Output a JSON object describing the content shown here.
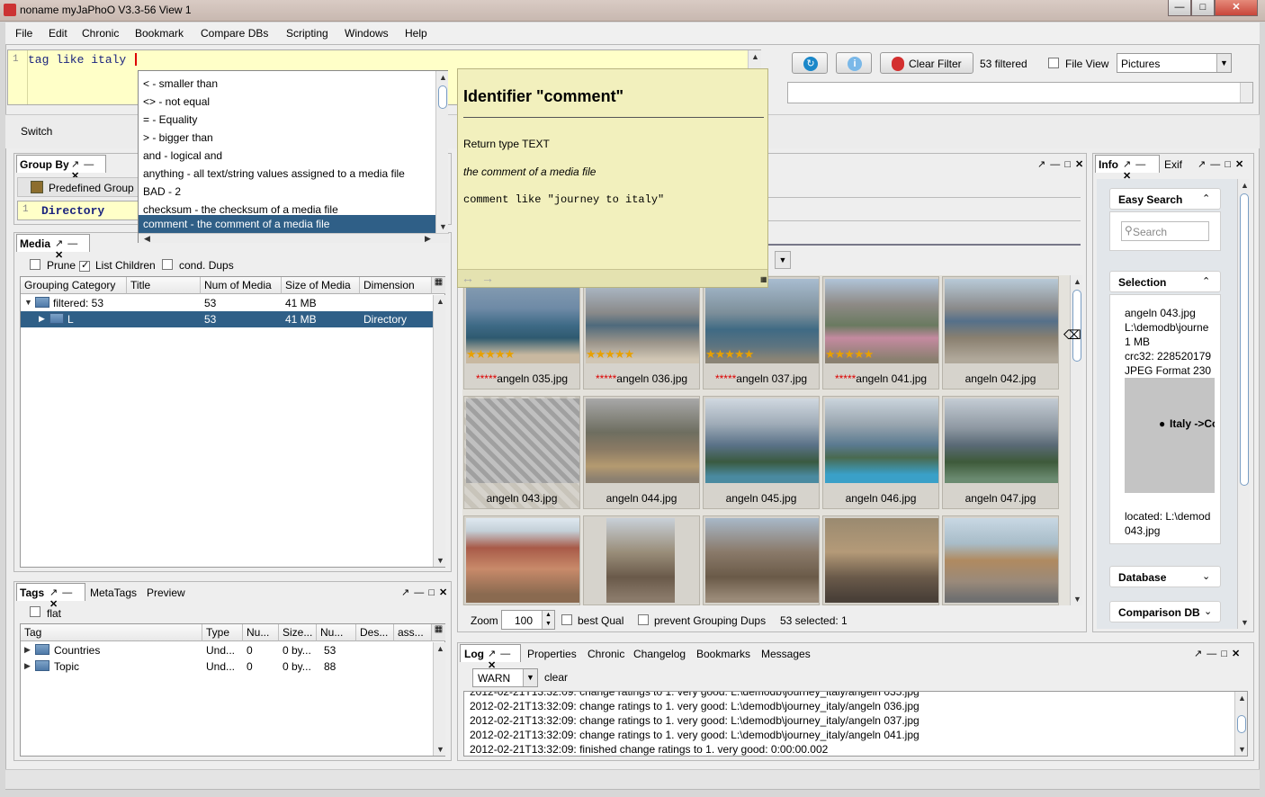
{
  "window": {
    "title": "noname myJaPhoO V3.3-56 View 1"
  },
  "menu": [
    "File",
    "Edit",
    "Chronic",
    "Bookmark",
    "Compare DBs",
    "Scripting",
    "Windows",
    "Help"
  ],
  "query": {
    "line_no": "1",
    "text": "tag like italy"
  },
  "toolbar": {
    "clear_filter": "Clear Filter",
    "filtered": "53 filtered",
    "file_view": "File View",
    "view_select": "Pictures"
  },
  "switch_label": "Switch",
  "autocomplete": [
    "< - smaller than",
    "<> - not equal",
    "= - Equality",
    "> - bigger than",
    "and - logical and",
    "anything - all text/string values assigned to a media file",
    "BAD - 2",
    "checksum - the checksum of a media file",
    "comment - the comment of a media file"
  ],
  "doc": {
    "title": "Identifier \"comment\"",
    "return_type": "Return type TEXT",
    "desc": "the comment of a media file",
    "example": "comment like \"journey to italy\""
  },
  "group_by": {
    "title": "Group By",
    "predefined": "Predefined Group",
    "line_no": "1",
    "value": "Directory"
  },
  "media": {
    "title": "Media",
    "prune": "Prune",
    "list_children": "List Children",
    "cond_dups": "cond. Dups",
    "columns": [
      "Grouping Category",
      "Title",
      "Num of Media",
      "Size of Media",
      "Dimension"
    ],
    "rows": [
      {
        "cat": "filtered: 53",
        "title": "",
        "num": "53",
        "size": "41 MB",
        "dim": ""
      },
      {
        "cat": "L",
        "title": "",
        "num": "53",
        "size": "41 MB",
        "dim": "Directory"
      }
    ]
  },
  "tags": {
    "tabs": [
      "Tags",
      "MetaTags",
      "Preview"
    ],
    "flat": "flat",
    "columns": [
      "Tag",
      "Type",
      "Nu...",
      "Size...",
      "Nu...",
      "Des...",
      "ass..."
    ],
    "rows": [
      {
        "tag": "Countries",
        "type": "Und...",
        "n1": "0",
        "size": "0 by...",
        "n2": "53"
      },
      {
        "tag": "Topic",
        "type": "Und...",
        "n1": "0",
        "size": "0 by...",
        "n2": "88"
      }
    ]
  },
  "thumbnails": {
    "row1": [
      "*****angeln 035.jpg",
      "*****angeln 036.jpg",
      "*****angeln 037.jpg",
      "*****angeln 041.jpg",
      "angeln 042.jpg"
    ],
    "row2": [
      "angeln 043.jpg",
      "angeln 044.jpg",
      "angeln 045.jpg",
      "angeln 046.jpg",
      "angeln 047.jpg"
    ],
    "zoom_label": "Zoom",
    "zoom": "100",
    "best_qual": "best Qual",
    "prevent_dups": "prevent Grouping Dups",
    "selected": "53 selected: 1"
  },
  "info": {
    "tabs": [
      "Info",
      "Exif"
    ],
    "easy_search": "Easy Search",
    "search_placeholder": "Search",
    "selection": "Selection",
    "sel_lines": [
      "angeln 043.jpg",
      "L:\\demodb\\journe",
      "1 MB",
      "crc32: 228520179",
      "JPEG Format 230"
    ],
    "map_label": "Italy ->Co",
    "located": "located: L:\\demod",
    "located2": "043.jpg",
    "database": "Database",
    "comparison": "Comparison DB"
  },
  "log": {
    "tabs": [
      "Log",
      "Properties",
      "Chronic",
      "Changelog",
      "Bookmarks",
      "Messages"
    ],
    "level": "WARN",
    "clear": "clear",
    "lines": [
      "2012-02-21T13:32:09: change ratings to 1. very good: L:\\demodb\\journey_italy/angeln 035.jpg",
      "2012-02-21T13:32:09: change ratings to 1. very good: L:\\demodb\\journey_italy/angeln 036.jpg",
      "2012-02-21T13:32:09: change ratings to 1. very good: L:\\demodb\\journey_italy/angeln 037.jpg",
      "2012-02-21T13:32:09: change ratings to 1. very good: L:\\demodb\\journey_italy/angeln 041.jpg",
      "2012-02-21T13:32:09: finished change ratings to 1. very good: 0:00:00.002"
    ]
  },
  "colors": {
    "selection": "#2f5f87",
    "query_bg": "#ffffc8",
    "doc_bg": "#f2f0bd"
  }
}
